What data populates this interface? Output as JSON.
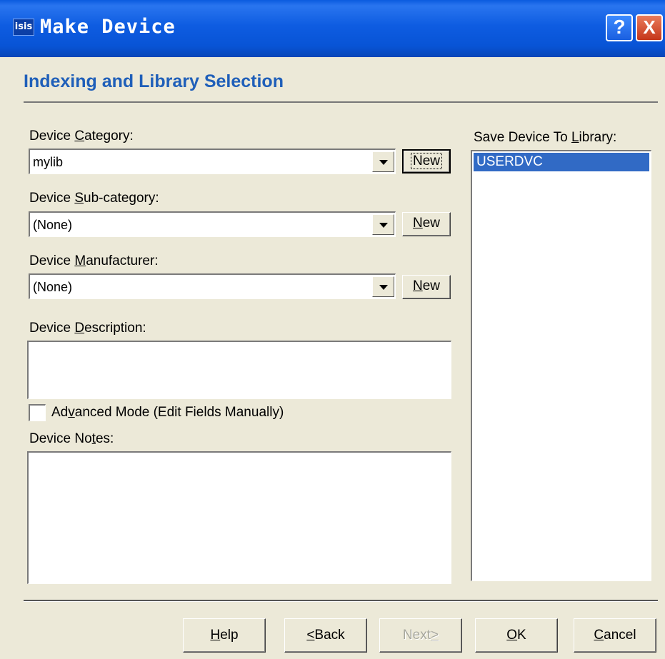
{
  "window": {
    "app_icon_text": "isis",
    "title": "Make Device",
    "help_button": "?",
    "close_button": "X"
  },
  "header": {
    "title": "Indexing and Library Selection"
  },
  "category": {
    "label_pre": "Device ",
    "label_ul": "C",
    "label_post": "ategory:",
    "value": "mylib",
    "new_label": "New"
  },
  "subcategory": {
    "label_pre": "Device ",
    "label_ul": "S",
    "label_post": "ub-category:",
    "value": "(None)",
    "new_ul": "N",
    "new_post": "ew"
  },
  "manufacturer": {
    "label_pre": "Device ",
    "label_ul": "M",
    "label_post": "anufacturer:",
    "value": "(None)",
    "new_ul": "N",
    "new_post": "ew"
  },
  "description": {
    "label_pre": "Device ",
    "label_ul": "D",
    "label_post": "escription:",
    "value": ""
  },
  "advanced": {
    "label_pre": "Ad",
    "label_ul": "v",
    "label_post": "anced Mode (Edit Fields Manually)",
    "checked": false
  },
  "notes": {
    "label_pre": "Device No",
    "label_ul": "t",
    "label_post": "es:",
    "value": ""
  },
  "library": {
    "label_pre": "Save Device To ",
    "label_ul": "L",
    "label_post": "ibrary:",
    "items": [
      "USERDVC"
    ],
    "selected": "USERDVC"
  },
  "footer": {
    "help_ul": "H",
    "help_post": "elp",
    "back_ul": "<",
    "back_post": "Back",
    "next_pre": "Next",
    "next_ul": ">",
    "ok_ul": "O",
    "ok_post": "K",
    "cancel_ul": "C",
    "cancel_post": "ancel"
  }
}
